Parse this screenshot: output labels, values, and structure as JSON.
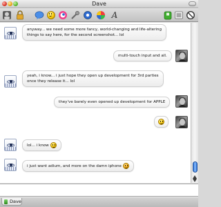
{
  "window": {
    "title": "Dave"
  },
  "toolbar": {
    "buttons": [
      {
        "icon": "user-info-icon"
      },
      {
        "icon": "lock-icon"
      },
      {
        "icon": "chat-bubble-icon"
      },
      {
        "icon": "smiley-icon"
      },
      {
        "icon": "color-face-icon"
      },
      {
        "icon": "tools-icon"
      },
      {
        "icon": "settings-gear-icon"
      },
      {
        "icon": "color-wheel-icon"
      },
      {
        "icon": "font-icon",
        "glyph": "A"
      },
      {
        "icon": "contact-green-icon"
      },
      {
        "icon": "send-file-icon"
      },
      {
        "icon": "block-icon"
      }
    ]
  },
  "messages": [
    {
      "direction": "incoming",
      "lines": [
        "anyway... we need some more fancy, world-changing and life-altering",
        "things to say here, for the second screenshot... lol"
      ]
    },
    {
      "direction": "outgoing",
      "lines": [
        "multi-touch input and all."
      ]
    },
    {
      "direction": "incoming",
      "lines": [
        "yeah, i know... i just hope they open up development for 3rd parties",
        "once they release it... lol"
      ]
    },
    {
      "direction": "outgoing",
      "lines": [
        "they've barely even opened up development for APPLE"
      ]
    },
    {
      "direction": "outgoing",
      "lines": [
        ""
      ],
      "emoticon": "smiley"
    },
    {
      "direction": "incoming",
      "lines": [
        "lol... i know"
      ],
      "emoticon": "smiley"
    },
    {
      "direction": "incoming",
      "lines": [
        "i just want adium, and more on the damn iphone"
      ],
      "emoticon": "grin"
    }
  ],
  "input": {
    "value": ""
  },
  "tabs": [
    {
      "label": "Dave"
    }
  ]
}
